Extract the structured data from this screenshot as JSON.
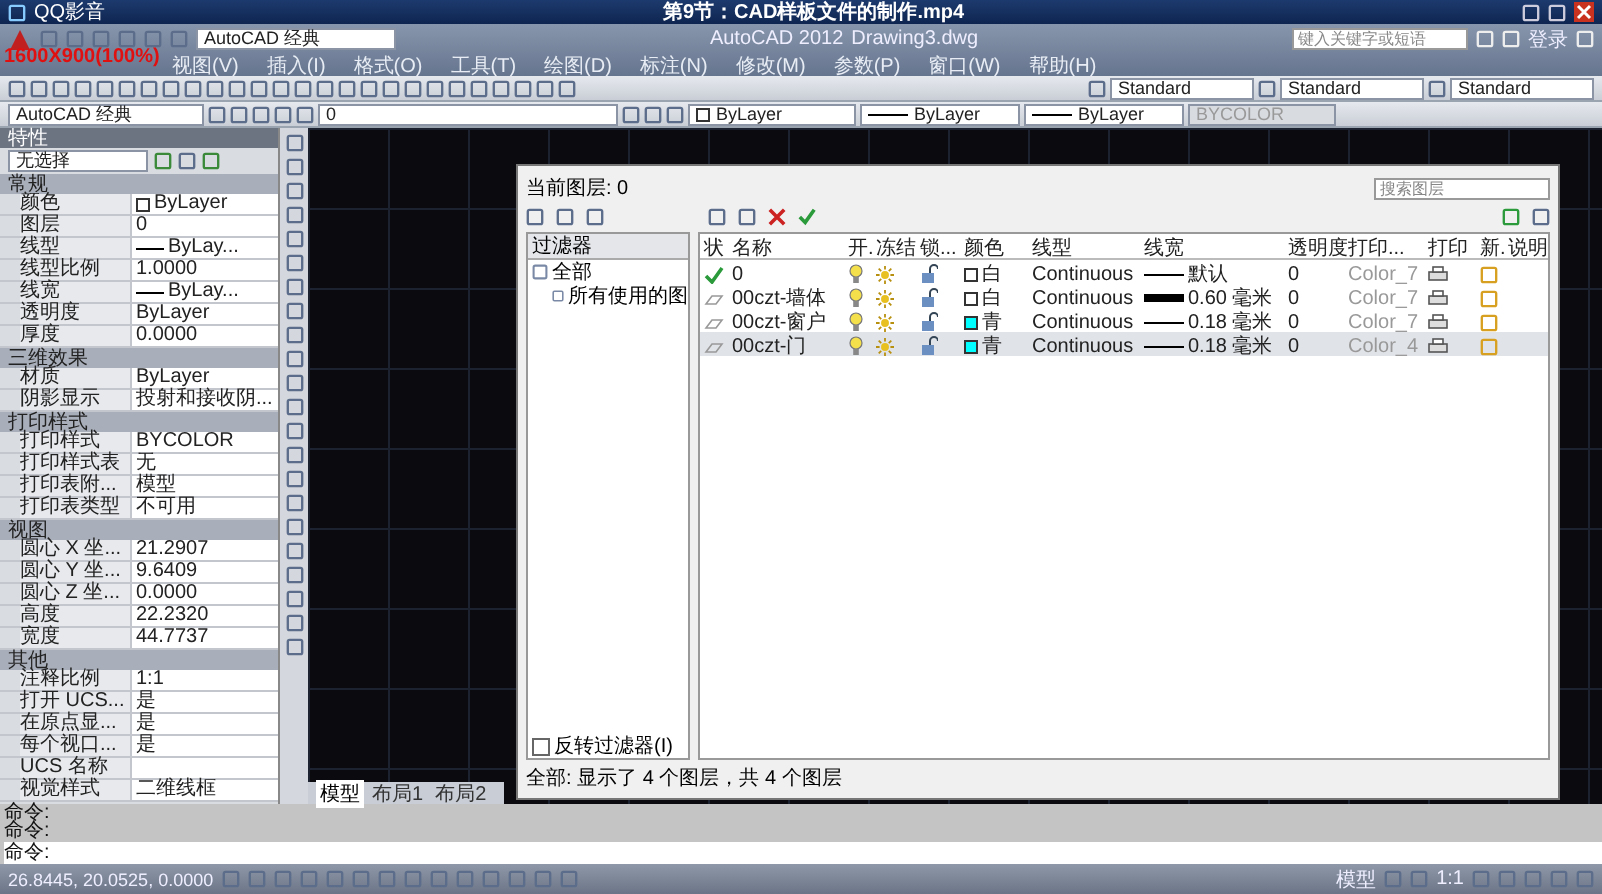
{
  "player": {
    "app": "QQ影音",
    "title": "第9节：CAD样板文件的制作.mp4",
    "overlay": "1600X900(100%)"
  },
  "app": {
    "workspace": "AutoCAD 经典",
    "title": "AutoCAD 2012",
    "file": "Drawing3.dwg",
    "search_placeholder": "键入关键字或短语",
    "login": "登录"
  },
  "menu": [
    "视图(V)",
    "插入(I)",
    "格式(O)",
    "工具(T)",
    "绘图(D)",
    "标注(N)",
    "修改(M)",
    "参数(P)",
    "窗口(W)",
    "帮助(H)"
  ],
  "styles": [
    "Standard",
    "Standard",
    "Standard"
  ],
  "layer_bar": {
    "workspace": "AutoCAD 经典",
    "layer": "0",
    "color_label": "ByLayer",
    "linetype": "ByLayer",
    "lineweight": "ByLayer",
    "plotstyle": "BYCOLOR"
  },
  "properties": {
    "title": "特性",
    "selection": "无选择",
    "sections": [
      {
        "title": "常规",
        "rows": [
          {
            "label": "颜色",
            "value": "ByLayer",
            "kind": "swatch"
          },
          {
            "label": "图层",
            "value": "0",
            "kind": "text"
          },
          {
            "label": "线型",
            "value": "ByLay...",
            "kind": "line"
          },
          {
            "label": "线型比例",
            "value": "1.0000",
            "kind": "text"
          },
          {
            "label": "线宽",
            "value": "ByLay...",
            "kind": "line"
          },
          {
            "label": "透明度",
            "value": "ByLayer",
            "kind": "text"
          },
          {
            "label": "厚度",
            "value": "0.0000",
            "kind": "text"
          }
        ]
      },
      {
        "title": "三维效果",
        "rows": [
          {
            "label": "材质",
            "value": "ByLayer",
            "kind": "text"
          },
          {
            "label": "阴影显示",
            "value": "投射和接收阴...",
            "kind": "text"
          }
        ]
      },
      {
        "title": "打印样式",
        "rows": [
          {
            "label": "打印样式",
            "value": "BYCOLOR",
            "kind": "text"
          },
          {
            "label": "打印样式表",
            "value": "无",
            "kind": "text"
          },
          {
            "label": "打印表附...",
            "value": "模型",
            "kind": "text"
          },
          {
            "label": "打印表类型",
            "value": "不可用",
            "kind": "text"
          }
        ]
      },
      {
        "title": "视图",
        "rows": [
          {
            "label": "圆心 X 坐...",
            "value": "21.2907",
            "kind": "text"
          },
          {
            "label": "圆心 Y 坐...",
            "value": "9.6409",
            "kind": "text"
          },
          {
            "label": "圆心 Z 坐...",
            "value": "0.0000",
            "kind": "text"
          },
          {
            "label": "高度",
            "value": "22.2320",
            "kind": "text"
          },
          {
            "label": "宽度",
            "value": "44.7737",
            "kind": "text"
          }
        ]
      },
      {
        "title": "其他",
        "rows": [
          {
            "label": "注释比例",
            "value": "1:1",
            "kind": "text"
          },
          {
            "label": "打开 UCS...",
            "value": "是",
            "kind": "text"
          },
          {
            "label": "在原点显...",
            "value": "是",
            "kind": "text"
          },
          {
            "label": "每个视口...",
            "value": "是",
            "kind": "text"
          },
          {
            "label": "UCS 名称",
            "kind": "text"
          },
          {
            "label": "视觉样式",
            "value": "二维线框",
            "kind": "text"
          }
        ]
      }
    ]
  },
  "layer_dialog": {
    "current": "当前图层: 0",
    "search_placeholder": "搜索图层",
    "tree": {
      "label": "过滤器",
      "children": [
        {
          "label": "全部",
          "children": [
            {
              "label": "所有使用的图"
            }
          ]
        }
      ]
    },
    "invert": {
      "label": "反转过滤器(I)",
      "checked": false
    },
    "columns": [
      "状",
      "名称",
      "开.",
      "冻结",
      "锁...",
      "颜色",
      "线型",
      "线宽",
      "透明度",
      "打印...",
      "打印",
      "新.",
      "说明"
    ],
    "layers": [
      {
        "name": "0",
        "current": true,
        "on": true,
        "frozen": false,
        "locked": false,
        "color_name": "白",
        "color": "#ffffff",
        "linetype": "Continuous",
        "lineweight": "默认",
        "transparency": "0",
        "plot_style": "Color_7",
        "selected": false
      },
      {
        "name": "00czt-墙体",
        "current": false,
        "on": true,
        "frozen": false,
        "locked": false,
        "color_name": "白",
        "color": "#ffffff",
        "linetype": "Continuous",
        "lineweight": "0.60 毫米",
        "transparency": "0",
        "plot_style": "Color_7",
        "selected": false
      },
      {
        "name": "00czt-窗户",
        "current": false,
        "on": true,
        "frozen": false,
        "locked": false,
        "color_name": "青",
        "color": "#00ffff",
        "linetype": "Continuous",
        "lineweight": "0.18 毫米",
        "transparency": "0",
        "plot_style": "Color_7",
        "selected": false
      },
      {
        "name": "00czt-门",
        "current": false,
        "on": true,
        "frozen": false,
        "locked": false,
        "color_name": "青",
        "color": "#00ffff",
        "linetype": "Continuous",
        "lineweight": "0.18 毫米",
        "transparency": "0",
        "plot_style": "Color_4",
        "selected": true
      }
    ],
    "status": "全部: 显示了 4 个图层，共 4 个图层"
  },
  "layout_tabs": [
    {
      "label": "模型",
      "selected": true
    },
    {
      "label": "布局1",
      "selected": false
    },
    {
      "label": "布局2",
      "selected": false
    }
  ],
  "command_lines": [
    "命令:",
    "命令:",
    "命令:"
  ],
  "status_bar": {
    "coords": "26.8445, 20.0525, 0.0000",
    "model": "模型",
    "scale": "1:1"
  }
}
